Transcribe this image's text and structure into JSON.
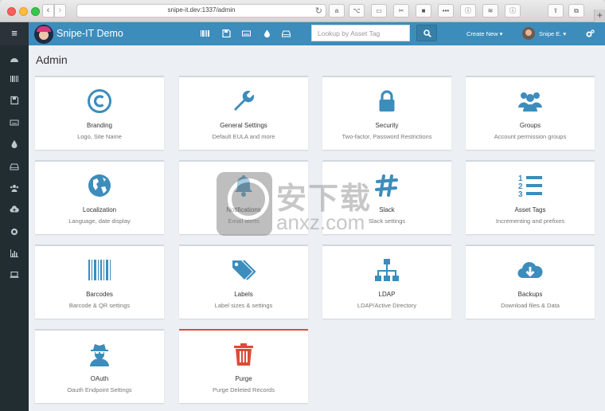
{
  "browser": {
    "url": "snipe-it.dev:1337/admin",
    "nav_back": "‹",
    "nav_forward": "›",
    "reload": "↻",
    "new_tab": "+"
  },
  "app": {
    "brand": "Snipe-IT Demo",
    "search_placeholder": "Lookup by Asset Tag",
    "create_new": "Create New ▾",
    "user_name": "Snipe E. ▾",
    "accent_color": "#3c8dbc",
    "sidebar_color": "#222d32"
  },
  "page": {
    "title": "Admin"
  },
  "cards": [
    {
      "title": "Branding",
      "desc": "Logo, Site Name",
      "icon": "copyright-icon"
    },
    {
      "title": "General Settings",
      "desc": "Default EULA and more",
      "icon": "wrench-icon"
    },
    {
      "title": "Security",
      "desc": "Two-factor, Password Restrictions",
      "icon": "lock-icon"
    },
    {
      "title": "Groups",
      "desc": "Account permission groups",
      "icon": "users-icon"
    },
    {
      "title": "Localization",
      "desc": "Language, date display",
      "icon": "globe-icon"
    },
    {
      "title": "Notifications",
      "desc": "Email alerts",
      "icon": "bell-icon"
    },
    {
      "title": "Slack",
      "desc": "Slack settings",
      "icon": "slack-icon"
    },
    {
      "title": "Asset Tags",
      "desc": "Incrementing and prefixes",
      "icon": "list-ol-icon"
    },
    {
      "title": "Barcodes",
      "desc": "Barcode & QR settings",
      "icon": "barcode-icon"
    },
    {
      "title": "Labels",
      "desc": "Label sizes & settings",
      "icon": "tags-icon"
    },
    {
      "title": "LDAP",
      "desc": "LDAP/Active Directory",
      "icon": "sitemap-icon"
    },
    {
      "title": "Backups",
      "desc": "Download files & Data",
      "icon": "cloud-download-icon"
    },
    {
      "title": "OAuth",
      "desc": "Oauth Endpoint Settings",
      "icon": "user-secret-icon"
    },
    {
      "title": "Purge",
      "desc": "Purge Deleted Records",
      "icon": "trash-icon",
      "status_color": "#dd4b39"
    }
  ],
  "watermark": {
    "main": "安下载",
    "sub": "anxz.com"
  }
}
